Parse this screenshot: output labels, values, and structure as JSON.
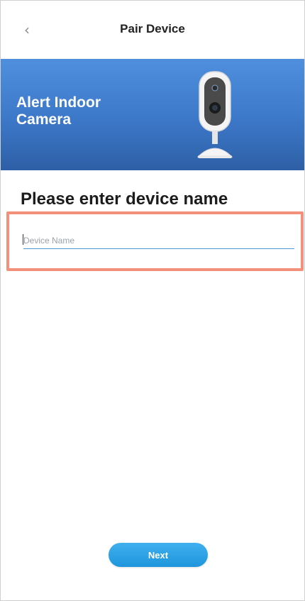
{
  "header": {
    "back_icon": "chevron-left-icon",
    "back_glyph": "‹",
    "title": "Pair Device"
  },
  "banner": {
    "device_title": "Alert Indoor Camera",
    "image": "indoor-camera-icon",
    "colors": {
      "top": "#4f8fde",
      "bottom": "#2e5fa6"
    }
  },
  "form": {
    "heading": "Please enter device name",
    "device_name": {
      "value": "",
      "placeholder": "Device Name"
    }
  },
  "footer": {
    "next_label": "Next",
    "accent_color": "#1e95dc"
  },
  "highlight_color": "#f2907b"
}
